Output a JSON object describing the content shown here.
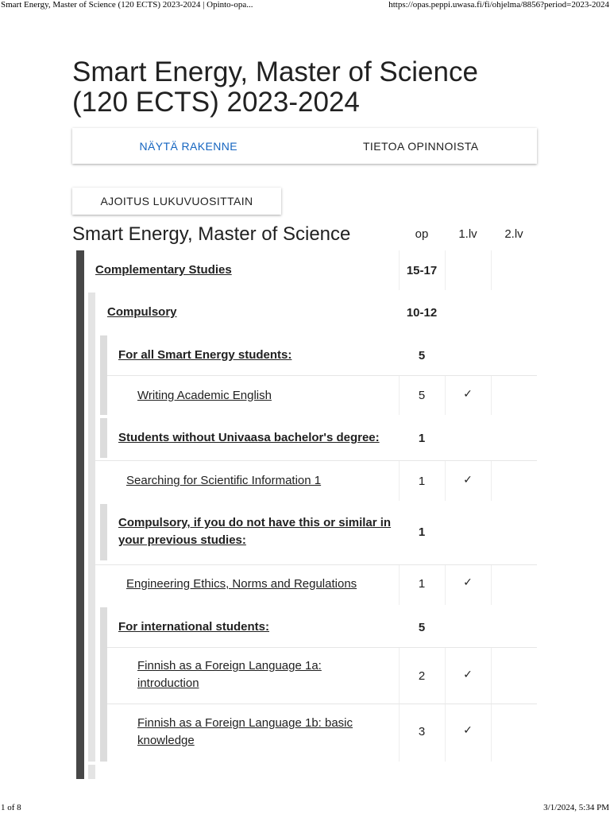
{
  "print_header": {
    "title": "Smart Energy, Master of Science (120 ECTS) 2023-2024 | Opinto-opa...",
    "url": "https://opas.peppi.uwasa.fi/fi/ohjelma/8856?period=2023-2024"
  },
  "print_footer": {
    "page": "1 of 8",
    "datetime": "3/1/2024, 5:34 PM"
  },
  "page": {
    "title_line1": "Smart Energy, Master of Science",
    "title_line2": "(120 ECTS) 2023-2024"
  },
  "tabs": [
    {
      "label": "NÄYTÄ RAKENNE",
      "active": true
    },
    {
      "label": "TIETOA OPINNOISTA",
      "active": false
    }
  ],
  "schedule_button": {
    "label": "AJOITUS LUKUVUOSITTAIN"
  },
  "table": {
    "title": "Smart Energy, Master of Science",
    "columns": {
      "op": "op",
      "year1": "1.lv",
      "year2": "2.lv"
    },
    "check_glyph": "✓",
    "rows": [
      {
        "label": "Complementary Studies",
        "op": "15-17",
        "group": true,
        "y1": "",
        "y2": ""
      },
      {
        "label": "Compulsory",
        "op": "10-12",
        "group": true,
        "y1": "",
        "y2": ""
      },
      {
        "label": "For all Smart Energy students:",
        "op": "5",
        "group": true,
        "y1": "",
        "y2": ""
      },
      {
        "label": "Writing Academic English",
        "op": "5",
        "group": false,
        "y1": "✓",
        "y2": ""
      },
      {
        "label": "Students without Univaasa bachelor's degree:",
        "op": "1",
        "group": true,
        "y1": "",
        "y2": ""
      },
      {
        "label": "Searching for Scientific Information 1",
        "op": "1",
        "group": false,
        "y1": "✓",
        "y2": ""
      },
      {
        "label_line1": "Compulsory, if you do not have this or similar in",
        "label_line2": "your previous studies:",
        "op": "1",
        "group": true,
        "y1": "",
        "y2": ""
      },
      {
        "label": "Engineering Ethics, Norms and Regulations",
        "op": "1",
        "group": false,
        "y1": "✓",
        "y2": ""
      },
      {
        "label": "For international students:",
        "op": "5",
        "group": true,
        "y1": "",
        "y2": ""
      },
      {
        "label_line1": "Finnish as a Foreign Language 1a:",
        "label_line2": "introduction",
        "op": "2",
        "group": false,
        "y1": "✓",
        "y2": ""
      },
      {
        "label_line1": "Finnish as a Foreign Language 1b: basic",
        "label_line2": "knowledge",
        "op": "3",
        "group": false,
        "y1": "✓",
        "y2": ""
      }
    ]
  }
}
